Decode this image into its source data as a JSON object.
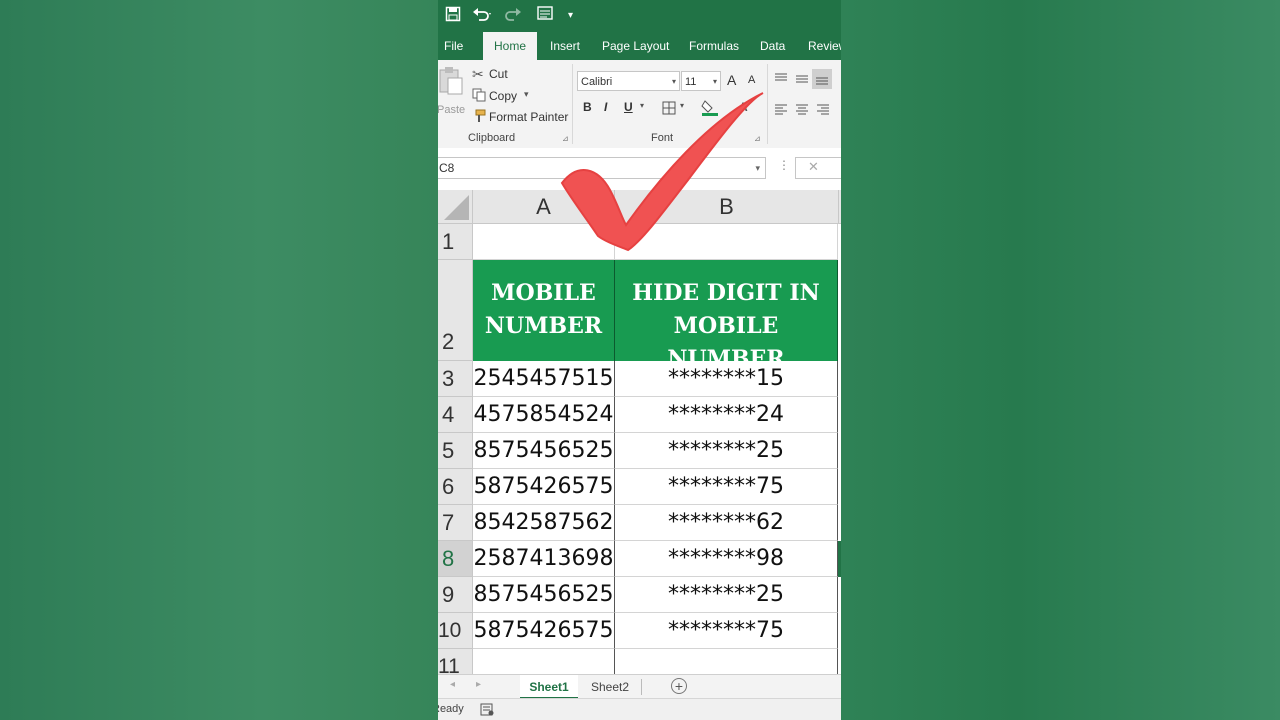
{
  "qat": {
    "icons": [
      "save-icon",
      "undo-icon",
      "redo-icon",
      "form-icon",
      "customize-icon"
    ]
  },
  "ribbon_tabs": [
    {
      "label": "File",
      "active": false
    },
    {
      "label": "Home",
      "active": true
    },
    {
      "label": "Insert",
      "active": false
    },
    {
      "label": "Page Layout",
      "active": false
    },
    {
      "label": "Formulas",
      "active": false
    },
    {
      "label": "Data",
      "active": false
    },
    {
      "label": "Review",
      "active": false
    }
  ],
  "clipboard": {
    "paste_label": "Paste",
    "cut_label": "Cut",
    "copy_label": "Copy",
    "format_painter_label": "Format Painter",
    "group_label": "Clipboard"
  },
  "font": {
    "font_name": "Calibri",
    "font_size": "11",
    "grow_label": "A",
    "shrink_label": "A",
    "bold_label": "B",
    "italic_label": "I",
    "underline_label": "U",
    "font_color_label": "A",
    "group_label": "Font"
  },
  "name_box": "C8",
  "formula_cancel": "✕",
  "columns": [
    "A",
    "B"
  ],
  "header": {
    "col_a": "MOBILE NUMBER",
    "col_b": "HIDE DIGIT IN MOBILE NUMBER"
  },
  "rows": [
    {
      "num": "1",
      "a": "",
      "b": ""
    },
    {
      "num": "2",
      "a": "",
      "b": ""
    },
    {
      "num": "3",
      "a": "2545457515",
      "b": "********15"
    },
    {
      "num": "4",
      "a": "4575854524",
      "b": "********24"
    },
    {
      "num": "5",
      "a": "8575456525",
      "b": "********25"
    },
    {
      "num": "6",
      "a": "5875426575",
      "b": "********75"
    },
    {
      "num": "7",
      "a": "8542587562",
      "b": "********62"
    },
    {
      "num": "8",
      "a": "2587413698",
      "b": "********98"
    },
    {
      "num": "9",
      "a": "8575456525",
      "b": "********25"
    },
    {
      "num": "10",
      "a": "5875426575",
      "b": "********75"
    },
    {
      "num": "11",
      "a": "",
      "b": ""
    }
  ],
  "sheets": [
    {
      "label": "Sheet1",
      "active": true
    },
    {
      "label": "Sheet2",
      "active": false
    }
  ],
  "add_sheet": "+",
  "status": "Ready",
  "colors": {
    "excel_green": "#217346",
    "header_fill": "#189b51",
    "check_red": "#f05252"
  }
}
